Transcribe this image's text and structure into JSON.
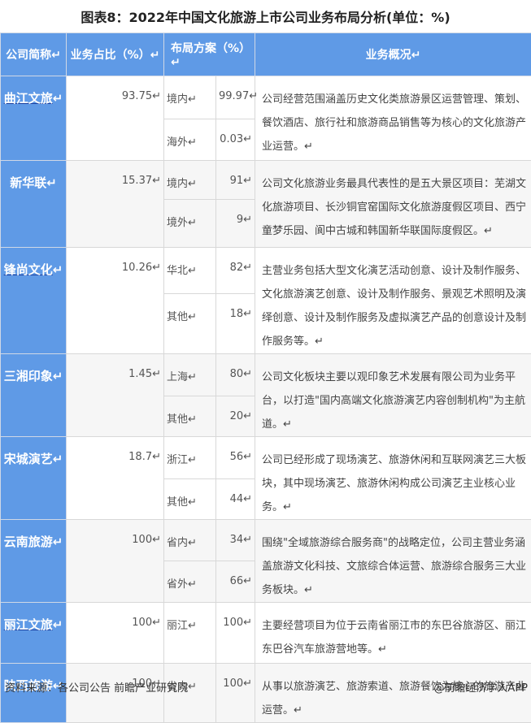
{
  "title": "图表8：2022年中国文化旅游上市公司业务布局分析(单位：%)",
  "headers": [
    "公司简称↵",
    "业务占比（%）↵",
    "布局方案（%）↵",
    "业务概况↵"
  ],
  "rows": [
    {
      "name": "曲江文旅",
      "share": "93.75↵",
      "regions": [
        {
          "r": "境内↵",
          "v": "99.97↵"
        },
        {
          "r": "海外↵",
          "v": "0.03↵"
        }
      ],
      "desc": "公司经营范围涵盖历史文化类旅游景区运营管理、策划、餐饮酒店、旅行社和旅游商品销售等为核心的文化旅游产业运营。↵"
    },
    {
      "name": "新华联",
      "share": "15.37↵",
      "regions": [
        {
          "r": "境内↵",
          "v": "91↵"
        },
        {
          "r": "境外↵",
          "v": "9↵"
        }
      ],
      "desc": "公司文化旅游业务最具代表性的是五大景区项目：芜湖文化旅游项目、长沙铜官窑国际文化旅游度假区项目、西宁童梦乐园、阆中古城和韩国新华联国际度假区。↵"
    },
    {
      "name": "锋尚文化",
      "share": "10.26↵",
      "regions": [
        {
          "r": "华北↵",
          "v": "82↵"
        },
        {
          "r": "其他↵",
          "v": "18↵"
        }
      ],
      "desc": "主营业务包括大型文化演艺活动创意、设计及制作服务、文化旅游演艺创意、设计及制作服务、景观艺术照明及演绎创意、设计及制作服务及虚拟演艺产品的创意设计及制作服务等。↵"
    },
    {
      "name": "三湘印象",
      "share": "1.45↵",
      "regions": [
        {
          "r": "上海↵",
          "v": "80↵"
        },
        {
          "r": "其他↵",
          "v": "20↵"
        }
      ],
      "desc": "公司文化板块主要以观印象艺术发展有限公司为业务平台，以打造\"国内高端文化旅游演艺内容创制机构\"为主航道。↵"
    },
    {
      "name": "宋城演艺",
      "share": "18.7↵",
      "regions": [
        {
          "r": "浙江↵",
          "v": "56↵"
        },
        {
          "r": "其他↵",
          "v": "44↵"
        }
      ],
      "desc": "公司已经形成了现场演艺、旅游休闲和互联网演艺三大板块，其中现场演艺、旅游休闲构成公司演艺主业核心业务。↵"
    },
    {
      "name": "云南旅游",
      "share": "100↵",
      "regions": [
        {
          "r": "省内↵",
          "v": "34↵"
        },
        {
          "r": "省外↵",
          "v": "66↵"
        }
      ],
      "desc": "围绕\"全域旅游综合服务商\"的战略定位，公司主营业务涵盖旅游文化科技、文旅综合体运营、旅游综合服务三大业务板块。↵"
    },
    {
      "name": "丽江文旅",
      "share": "100↵",
      "regions": [
        {
          "r": "丽江↵",
          "v": "100↵"
        }
      ],
      "desc": "主要经营项目为位于云南省丽江市的东巴谷旅游区、丽江东巴谷汽车旅游营地等。↵"
    },
    {
      "name": "陕西旅游",
      "share": "100↵",
      "regions": [
        {
          "r": "省内↵",
          "v": "100↵"
        }
      ],
      "desc": "从事以旅游演艺、旅游索道、旅游餐饮为核心的旅游产业运营。↵"
    }
  ],
  "footer": {
    "source": "资料来源：各公司公告 前瞻产业研究院",
    "brand": "@前瞻经济学人APP"
  },
  "colors": {
    "header_bg": "#5f9ae6",
    "alt_row": "#f6f6f6"
  }
}
